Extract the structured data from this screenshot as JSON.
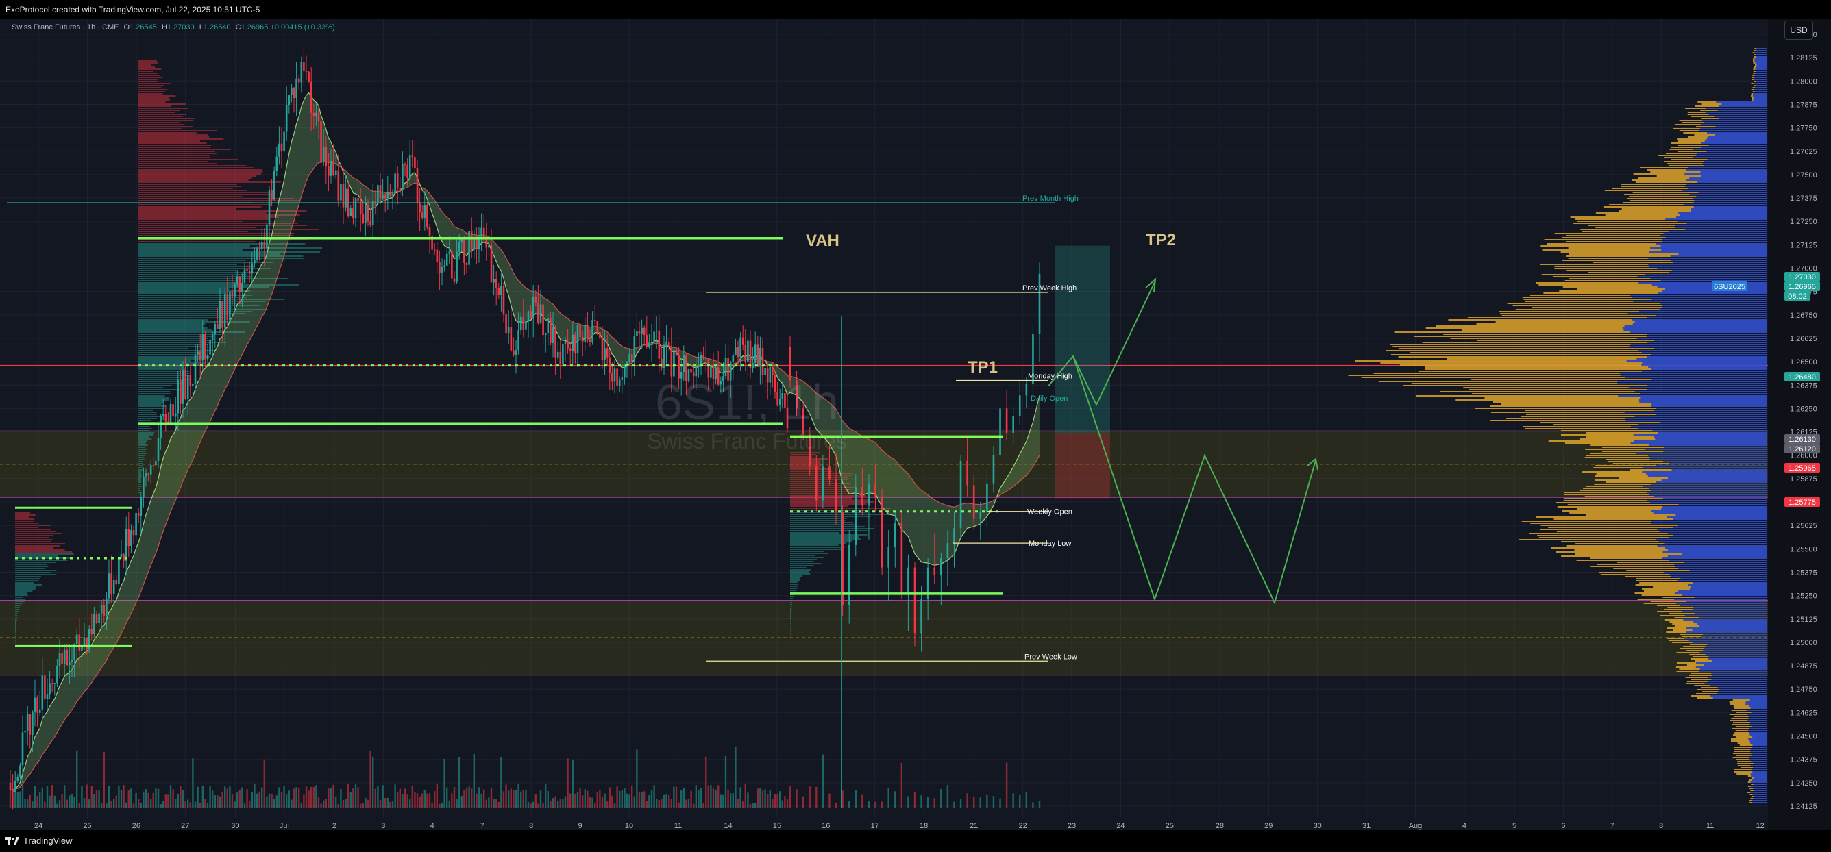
{
  "header": {
    "credit": "ExoProtocol created with TradingView.com, Jul 22, 2025 10:51 UTC-5"
  },
  "legend": {
    "symbol": "Swiss Franc Futures · 1h · CME",
    "open_label": "O",
    "open": "1.26545",
    "high_label": "H",
    "high": "1.27030",
    "low_label": "L",
    "low": "1.26540",
    "close_label": "C",
    "close": "1.26965",
    "change": "+0.00415 (+0.33%)"
  },
  "currency_button": "USD",
  "watermark": {
    "ticker": "6S1!, 1h",
    "name": "Swiss Franc Futures"
  },
  "footer": {
    "brand": "TradingView"
  },
  "annotations": {
    "vah": "VAH",
    "tp1": "TP1",
    "tp2": "TP2",
    "prev_month_high": "Prev Month High",
    "prev_week_high": "Prev Week High",
    "monday_high": "Monday High",
    "daily_open": "Daily Open",
    "weekly_open": "Weekly Open",
    "monday_low": "Monday Low",
    "prev_week_low": "Prev Week Low"
  },
  "chart_data": {
    "type": "candlestick",
    "symbol": "6S1!",
    "timeframe": "1h",
    "ylim": [
      1.2405,
      1.2835
    ],
    "y_ticks": [
      1.2825,
      1.28125,
      1.28,
      1.27875,
      1.2775,
      1.27625,
      1.275,
      1.27375,
      1.2725,
      1.27125,
      1.27,
      1.26875,
      1.2675,
      1.26625,
      1.265,
      1.26375,
      1.2625,
      1.26125,
      1.26,
      1.25875,
      1.2575,
      1.25625,
      1.255,
      1.25375,
      1.2525,
      1.25125,
      1.25,
      1.24875,
      1.2475,
      1.24625,
      1.245,
      1.24375,
      1.2425,
      1.24125
    ],
    "x_ticks": [
      "24",
      "25",
      "26",
      "27",
      "30",
      "Jul",
      "2",
      "3",
      "4",
      "7",
      "8",
      "9",
      "10",
      "11",
      "14",
      "15",
      "16",
      "17",
      "18",
      "21",
      "22",
      "23",
      "24",
      "25",
      "28",
      "29",
      "30",
      "31",
      "Aug",
      "4",
      "5",
      "6",
      "7",
      "8",
      "11",
      "12"
    ],
    "price_badges": [
      {
        "value": "1.27030",
        "color": "#26a69a"
      },
      {
        "value": "6SU2025",
        "color": "#2a7fd4"
      },
      {
        "value": "1.26965",
        "color": "#26a69a"
      },
      {
        "value": "08:02",
        "color": "#26a69a"
      },
      {
        "value": "1.26480",
        "color": "#26a69a"
      },
      {
        "value": "1.26130",
        "color": "#5d606b"
      },
      {
        "value": "1.26120",
        "color": "#5d606b"
      },
      {
        "value": "1.25965",
        "color": "#f23645"
      },
      {
        "value": "1.25775",
        "color": "#f23645"
      }
    ],
    "levels": [
      {
        "label": "Prev Month High",
        "value": 1.2735
      },
      {
        "label": "VAH",
        "value": 1.2716
      },
      {
        "label": "Prev Week High",
        "value": 1.2687
      },
      {
        "label": "Monday High",
        "value": 1.264
      },
      {
        "label": "Daily Open",
        "value": 1.263
      },
      {
        "label": "Weekly Open",
        "value": 1.257
      },
      {
        "label": "Monday Low",
        "value": 1.2553
      },
      {
        "label": "Prev Week Low",
        "value": 1.249
      },
      {
        "label": "TP1",
        "value": 1.2643
      },
      {
        "label": "TP2",
        "value": 1.271
      }
    ],
    "candles_jul15_22": [
      [
        1.2658,
        1.2664,
        1.2636,
        1.264
      ],
      [
        1.264,
        1.2645,
        1.2621,
        1.2625
      ],
      [
        1.2625,
        1.2629,
        1.2608,
        1.2611
      ],
      [
        1.2611,
        1.2615,
        1.2589,
        1.2594
      ],
      [
        1.2594,
        1.26,
        1.257,
        1.2576
      ],
      [
        1.2576,
        1.26,
        1.2572,
        1.2594
      ],
      [
        1.2594,
        1.2606,
        1.2584,
        1.2587
      ],
      [
        1.2587,
        1.2601,
        1.2563,
        1.257
      ],
      [
        1.257,
        1.2573,
        1.2514,
        1.252
      ],
      [
        1.252,
        1.256,
        1.251,
        1.2552
      ],
      [
        1.2552,
        1.259,
        1.2546,
        1.2583
      ],
      [
        1.2583,
        1.2593,
        1.2568,
        1.2573
      ],
      [
        1.2573,
        1.259,
        1.2555,
        1.2585
      ],
      [
        1.2585,
        1.2595,
        1.257,
        1.2578
      ],
      [
        1.2578,
        1.2582,
        1.2536,
        1.254
      ],
      [
        1.254,
        1.256,
        1.2522,
        1.2551
      ],
      [
        1.2551,
        1.257,
        1.254,
        1.2564
      ],
      [
        1.2564,
        1.257,
        1.2523,
        1.2526
      ],
      [
        1.2526,
        1.2547,
        1.2506,
        1.254
      ],
      [
        1.254,
        1.2543,
        1.2498,
        1.2505
      ],
      [
        1.2505,
        1.253,
        1.2495,
        1.2523
      ],
      [
        1.2523,
        1.2545,
        1.2512,
        1.254
      ],
      [
        1.254,
        1.2558,
        1.2531,
        1.2536
      ],
      [
        1.2536,
        1.2548,
        1.252,
        1.2545
      ],
      [
        1.2545,
        1.256,
        1.253,
        1.2553
      ],
      [
        1.2553,
        1.257,
        1.254,
        1.2561
      ],
      [
        1.2561,
        1.26,
        1.2555,
        1.2597
      ],
      [
        1.2597,
        1.261,
        1.2578,
        1.2584
      ],
      [
        1.2584,
        1.259,
        1.256,
        1.2566
      ],
      [
        1.2566,
        1.2575,
        1.2555,
        1.257
      ],
      [
        1.257,
        1.259,
        1.2562,
        1.2585
      ],
      [
        1.2585,
        1.2605,
        1.258,
        1.26
      ],
      [
        1.26,
        1.263,
        1.2595,
        1.2625
      ],
      [
        1.2625,
        1.2635,
        1.2608,
        1.2612
      ],
      [
        1.2612,
        1.2626,
        1.2606,
        1.2621
      ],
      [
        1.2621,
        1.264,
        1.2616,
        1.2632
      ],
      [
        1.2632,
        1.2642,
        1.2625,
        1.2638
      ],
      [
        1.2638,
        1.267,
        1.2632,
        1.2665
      ],
      [
        1.2665,
        1.2703,
        1.265,
        1.2697
      ]
    ]
  }
}
